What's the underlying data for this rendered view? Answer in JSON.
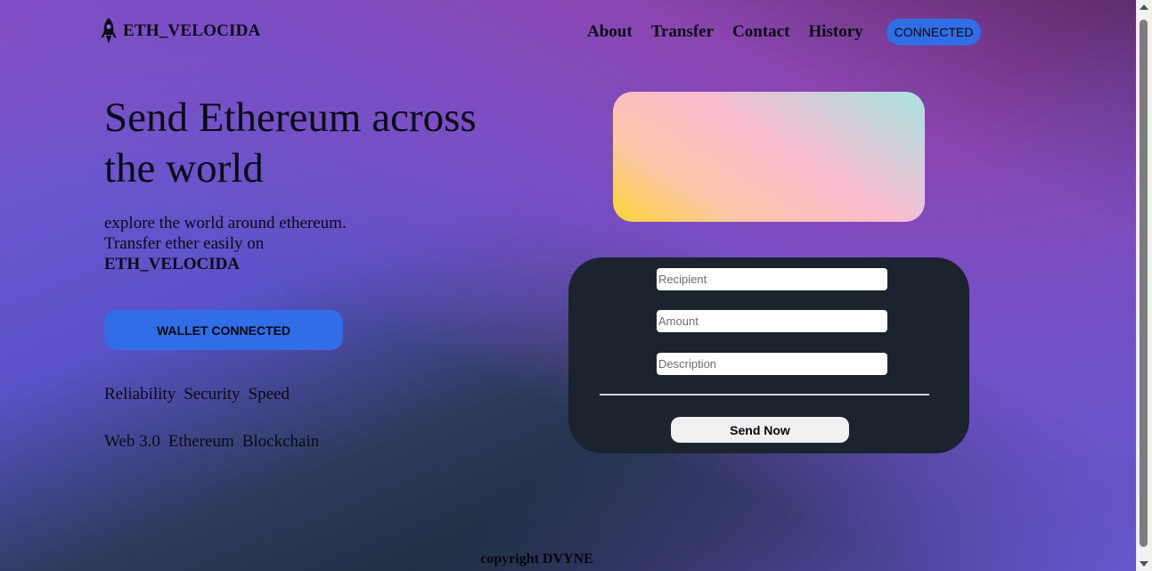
{
  "header": {
    "brand": "ETH_VELOCIDA",
    "brand_icon": "rocket-icon",
    "nav": [
      {
        "label": "About"
      },
      {
        "label": "Transfer"
      },
      {
        "label": "Contact"
      },
      {
        "label": "History"
      }
    ],
    "status_badge": "CONNECTED"
  },
  "hero": {
    "title": "Send Ethereum across the world",
    "subtitle_line": "explore the world around ethereum. Transfer ether easily on",
    "subtitle_brand": "ETH_VELOCIDA",
    "wallet_button": "WALLET CONNECTED",
    "features_row1": [
      "Reliability",
      "Security",
      "Speed"
    ],
    "features_row2": [
      "Web 3.0",
      "Ethereum",
      "Blockchain"
    ]
  },
  "form": {
    "recipient_placeholder": "Recipient",
    "amount_placeholder": "Amount",
    "description_placeholder": "Description",
    "send_button": "Send Now"
  },
  "footer": {
    "text": "copyright DVYNE"
  },
  "colors": {
    "accent_blue": "#2f6ee6",
    "form_panel": "#1a232e",
    "card_gradient": [
      "#a6e3df",
      "#fbbbd0",
      "#fdd335"
    ]
  }
}
